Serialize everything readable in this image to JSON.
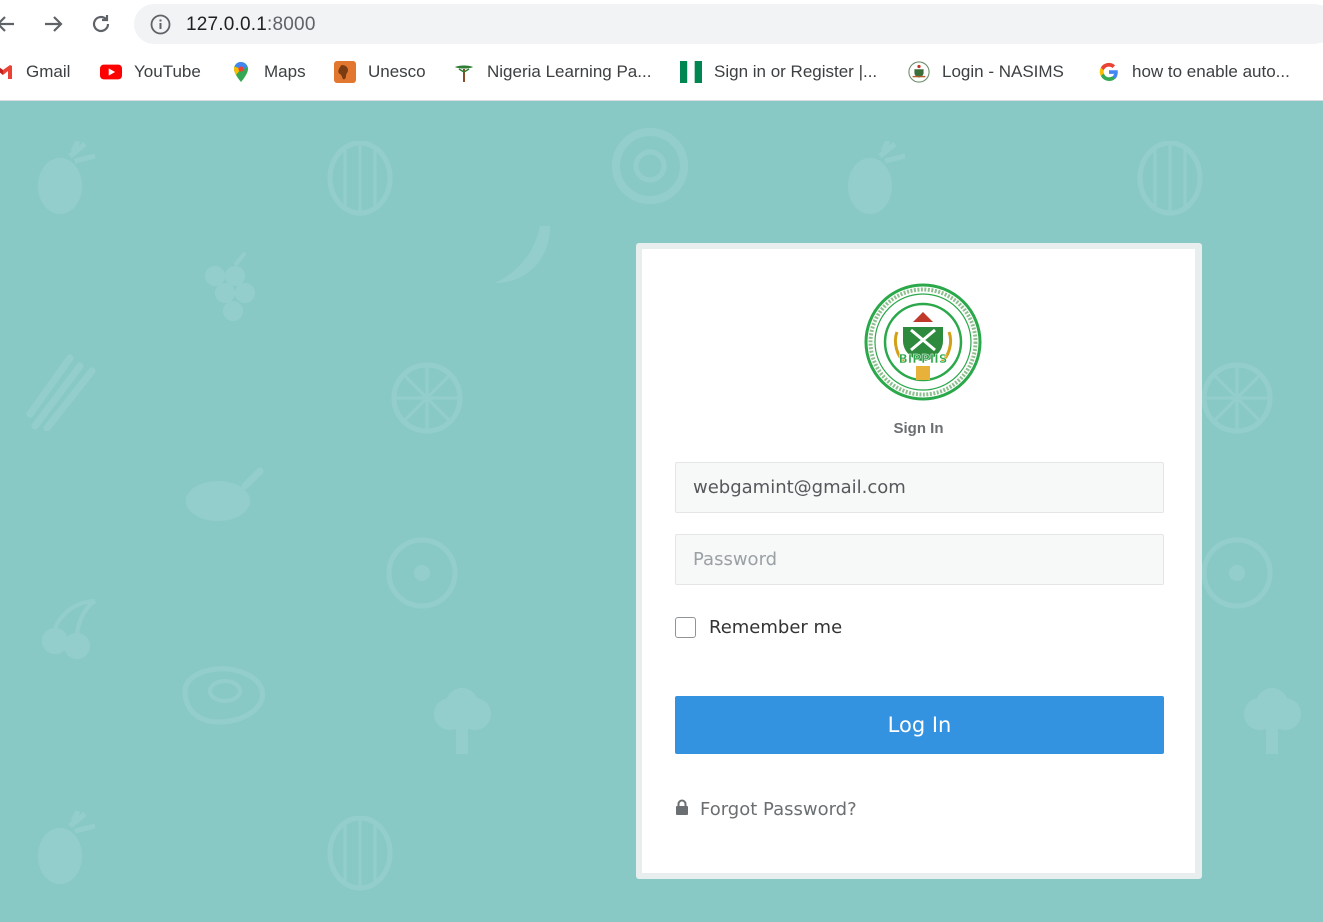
{
  "browser": {
    "url_host": "127.0.0.1",
    "url_port": ":8000",
    "bookmarks": [
      {
        "label": "Gmail",
        "icon": "gmail-icon"
      },
      {
        "label": "YouTube",
        "icon": "youtube-icon"
      },
      {
        "label": "Maps",
        "icon": "maps-icon"
      },
      {
        "label": "Unesco",
        "icon": "unesco-icon"
      },
      {
        "label": "Nigeria Learning Pa...",
        "icon": "tree-icon"
      },
      {
        "label": "Sign in or Register |...",
        "icon": "nigeria-flag-icon"
      },
      {
        "label": "Login - NASIMS",
        "icon": "coat-of-arms-icon"
      },
      {
        "label": "how to enable auto...",
        "icon": "google-icon"
      }
    ]
  },
  "login": {
    "logo_text": "BIPPIIS",
    "title": "Sign In",
    "email_value": "webgamint@gmail.com",
    "password_placeholder": "Password",
    "remember_label": "Remember me",
    "login_button": "Log In",
    "forgot_label": "Forgot Password?"
  },
  "colors": {
    "background": "#88c9c6",
    "button": "#3493e0",
    "logo_green": "#2aa84a"
  }
}
